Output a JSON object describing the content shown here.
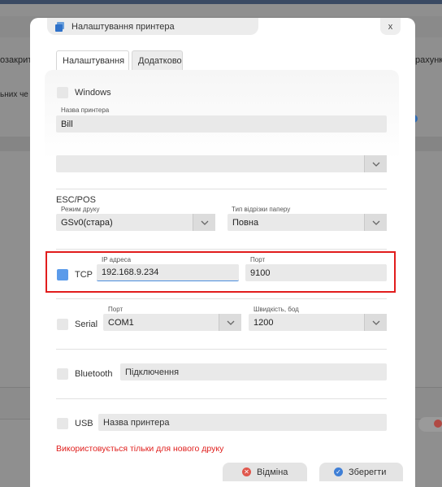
{
  "background": {
    "tab_left": "озакрит",
    "tab_right": "рахунк",
    "row_text": "ьних че"
  },
  "dialog": {
    "title": "Налаштування принтера",
    "close_label": "x",
    "tabs": [
      {
        "label": "Налаштування",
        "active": true
      },
      {
        "label": "Додатково",
        "active": false
      }
    ]
  },
  "form": {
    "windows_label": "Windows",
    "printer_name_label": "Назва принтера",
    "printer_name_value": "Bill",
    "printer_select_value": "",
    "esc_pos_label": "ESC/POS",
    "print_mode_label": "Режим друку",
    "print_mode_value": "GSv0(стара)",
    "cut_type_label": "Тип відрізки паперу",
    "cut_type_value": "Повна",
    "tcp": {
      "label": "TCP",
      "checked": true,
      "ip_label": "IP адреса",
      "ip_value": "192.168.9.234",
      "port_label": "Порт",
      "port_value": "9100"
    },
    "serial": {
      "label": "Serial",
      "port_label": "Порт",
      "port_value": "COM1",
      "baud_label": "Швидкість, бод",
      "baud_value": "1200"
    },
    "bluetooth": {
      "label": "Bluetooth",
      "placeholder": "Підключення"
    },
    "usb": {
      "label": "USB",
      "placeholder": "Назва принтера"
    },
    "warning": "Використовується тільки для нового друку"
  },
  "actions": {
    "cancel_label": "Відміна",
    "save_label": "Зберегти"
  },
  "colors": {
    "accent": "#5b9bea",
    "highlight": "#e11d1d",
    "warning": "#e0201e"
  }
}
